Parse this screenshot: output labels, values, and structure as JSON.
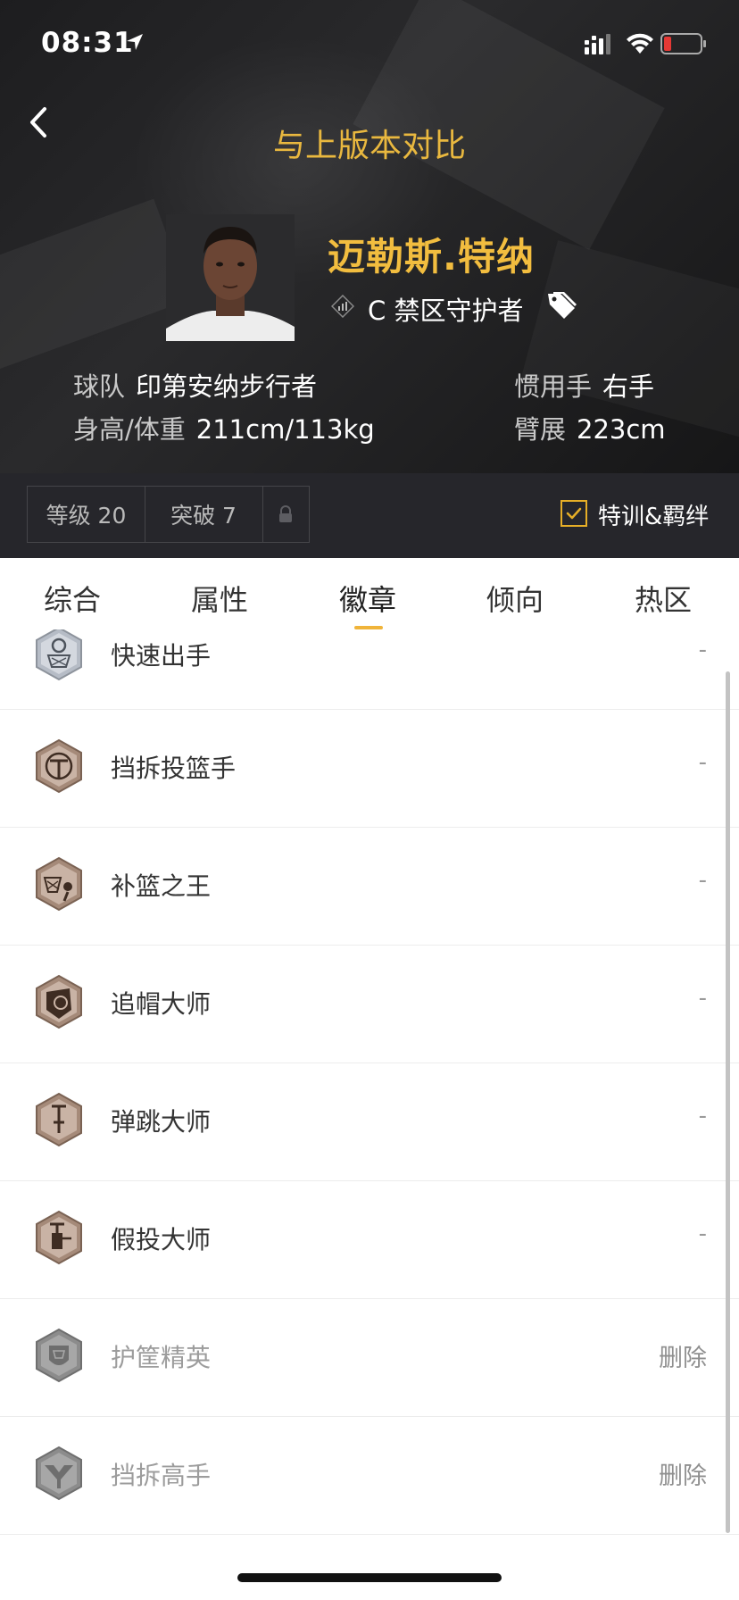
{
  "status": {
    "time": "08:31"
  },
  "header": {
    "title": "与上版本对比",
    "player_name": "迈勒斯.特纳",
    "position": "C 禁区守护者",
    "team_label": "球队",
    "team_value": "印第安纳步行者",
    "hw_label": "身高/体重",
    "hw_value": "211cm/113kg",
    "hand_label": "惯用手",
    "hand_value": "右手",
    "wingspan_label": "臂展",
    "wingspan_value": "223cm"
  },
  "level_bar": {
    "level": "等级 20",
    "breakthrough": "突破 7",
    "training_toggle": "特训&羁绊",
    "training_checked": true
  },
  "tabs": [
    {
      "label": "综合",
      "active": false
    },
    {
      "label": "属性",
      "active": false
    },
    {
      "label": "徽章",
      "active": true
    },
    {
      "label": "倾向",
      "active": false
    },
    {
      "label": "热区",
      "active": false
    }
  ],
  "badges": [
    {
      "name": "快速出手",
      "value": "-",
      "tier": "silver",
      "icon": "basketball-hoop-stopwatch-icon"
    },
    {
      "name": "挡拆投篮手",
      "value": "-",
      "tier": "bronze",
      "icon": "pick-and-roll-shooter-icon"
    },
    {
      "name": "补篮之王",
      "value": "-",
      "tier": "bronze",
      "icon": "putback-hoop-icon"
    },
    {
      "name": "追帽大师",
      "value": "-",
      "tier": "bronze",
      "icon": "chase-down-shield-icon"
    },
    {
      "name": "弹跳大师",
      "value": "-",
      "tier": "bronze",
      "icon": "pogo-stick-icon"
    },
    {
      "name": "假投大师",
      "value": "-",
      "tier": "bronze",
      "icon": "pump-fake-icon"
    },
    {
      "name": "护筐精英",
      "value": "删除",
      "tier": "gray",
      "icon": "rim-protector-icon"
    },
    {
      "name": "挡拆高手",
      "value": "删除",
      "tier": "gray",
      "icon": "pick-dodger-icon"
    }
  ],
  "colors": {
    "accent": "#f0b43a",
    "title_gold": "#e9b83f",
    "header_bg": "#1f1f21",
    "bar_bg": "#26262b",
    "bronze": "#9a7d6b",
    "silver": "#a9aeb8",
    "gray": "#8a8a8a"
  }
}
